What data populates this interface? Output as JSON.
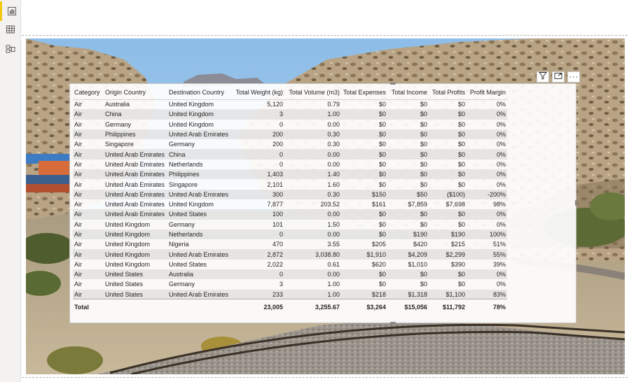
{
  "sidebar": {
    "items": [
      {
        "icon": "report-view-icon",
        "active": true
      },
      {
        "icon": "data-view-icon",
        "active": false
      },
      {
        "icon": "model-view-icon",
        "active": false
      }
    ]
  },
  "visual_header": {
    "icons": [
      "filter-icon",
      "focus-mode-icon",
      "more-options-icon"
    ],
    "more_label": "···"
  },
  "frame": {
    "more_label": "···"
  },
  "table": {
    "columns": [
      "Category",
      "Origin Country",
      "Destination Country",
      "Total Weight (kg)",
      "Total Volume (m3)",
      "Total Expenses",
      "Total Income",
      "Total Profits",
      "Profit Margin"
    ],
    "rows": [
      [
        "Air",
        "Australia",
        "United Kingdom",
        "5,120",
        "0.79",
        "$0",
        "$0",
        "$0",
        "0%"
      ],
      [
        "Air",
        "China",
        "United Kingdom",
        "3",
        "1.00",
        "$0",
        "$0",
        "$0",
        "0%"
      ],
      [
        "Air",
        "Germany",
        "United Kingdom",
        "0",
        "0.00",
        "$0",
        "$0",
        "$0",
        "0%"
      ],
      [
        "Air",
        "Philippines",
        "United Arab Emirates",
        "200",
        "0.30",
        "$0",
        "$0",
        "$0",
        "0%"
      ],
      [
        "Air",
        "Singapore",
        "Germany",
        "200",
        "0.30",
        "$0",
        "$0",
        "$0",
        "0%"
      ],
      [
        "Air",
        "United Arab Emirates",
        "China",
        "0",
        "0.00",
        "$0",
        "$0",
        "$0",
        "0%"
      ],
      [
        "Air",
        "United Arab Emirates",
        "Netherlands",
        "0",
        "0.00",
        "$0",
        "$0",
        "$0",
        "0%"
      ],
      [
        "Air",
        "United Arab Emirates",
        "Philippines",
        "1,403",
        "1.40",
        "$0",
        "$0",
        "$0",
        "0%"
      ],
      [
        "Air",
        "United Arab Emirates",
        "Singapore",
        "2,101",
        "1.60",
        "$0",
        "$0",
        "$0",
        "0%"
      ],
      [
        "Air",
        "United Arab Emirates",
        "United Arab Emirates",
        "300",
        "0.30",
        "$150",
        "$50",
        "($100)",
        "-200%"
      ],
      [
        "Air",
        "United Arab Emirates",
        "United Kingdom",
        "7,877",
        "203.52",
        "$161",
        "$7,859",
        "$7,698",
        "98%"
      ],
      [
        "Air",
        "United Arab Emirates",
        "United States",
        "100",
        "0.00",
        "$0",
        "$0",
        "$0",
        "0%"
      ],
      [
        "Air",
        "United Kingdom",
        "Germany",
        "101",
        "1.50",
        "$0",
        "$0",
        "$0",
        "0%"
      ],
      [
        "Air",
        "United Kingdom",
        "Netherlands",
        "0",
        "0.00",
        "$0",
        "$190",
        "$190",
        "100%"
      ],
      [
        "Air",
        "United Kingdom",
        "Nigeria",
        "470",
        "3.55",
        "$205",
        "$420",
        "$215",
        "51%"
      ],
      [
        "Air",
        "United Kingdom",
        "United Arab Emirates",
        "2,872",
        "3,038.80",
        "$1,910",
        "$4,209",
        "$2,299",
        "55%"
      ],
      [
        "Air",
        "United Kingdom",
        "United States",
        "2,022",
        "0.61",
        "$620",
        "$1,010",
        "$390",
        "39%"
      ],
      [
        "Air",
        "United States",
        "Australia",
        "0",
        "0.00",
        "$0",
        "$0",
        "$0",
        "0%"
      ],
      [
        "Air",
        "United States",
        "Germany",
        "3",
        "1.00",
        "$0",
        "$0",
        "$0",
        "0%"
      ],
      [
        "Air",
        "United States",
        "United Arab Emirates",
        "233",
        "1.00",
        "$218",
        "$1,318",
        "$1,100",
        "83%"
      ]
    ],
    "total": [
      "Total",
      "",
      "",
      "23,005",
      "3,255.67",
      "$3,264",
      "$15,056",
      "$11,792",
      "78%"
    ]
  },
  "colors": {
    "accent": "#f2c811",
    "sky": "#9fc7ec",
    "rock": "#b59c7e"
  }
}
